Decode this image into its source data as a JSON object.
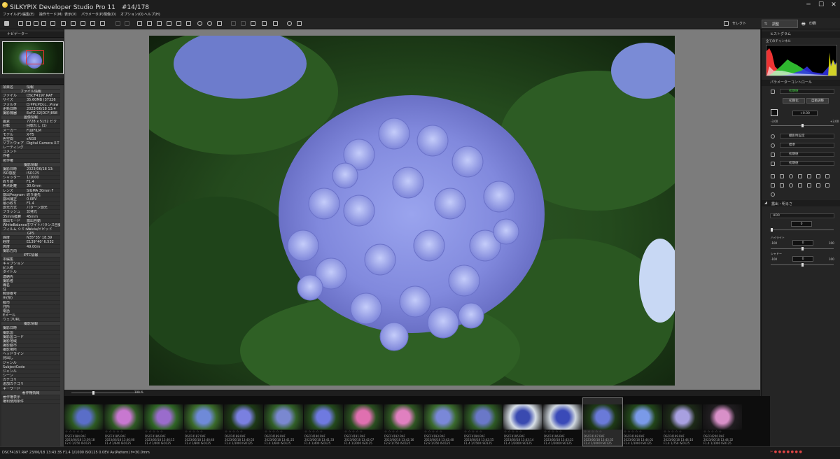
{
  "window": {
    "title": "SILKYPIX Developer Studio Pro 11　#14/178",
    "minimize": "─",
    "maximize": "☐",
    "close": "✕"
  },
  "menu": [
    "ファイル(F)",
    "編集(E)",
    "操作モード(M)",
    "表示(V)",
    "パラメータ(P)",
    "現像(D)",
    "オプション(O)",
    "ヘルプ(H)"
  ],
  "toolbar": {
    "select_label": "セレクト",
    "adjust_label": "調整",
    "print_label": "印刷"
  },
  "navigator": {
    "title": "ナビゲーター"
  },
  "info": {
    "col_key": "項目名",
    "col_val": "情報",
    "rows": [
      {
        "s": "ファイル情報"
      },
      {
        "k": "ファイル",
        "v": "DSCF4197.RAF"
      },
      {
        "k": "サイズ",
        "v": "35.60MB (37326"
      },
      {
        "k": "フォルダ",
        "v": "D:¥Pic¥Dcc...¥raw"
      },
      {
        "k": "更新日時",
        "v": "2023/06/18 13:4"
      },
      {
        "k": "撮影機器",
        "v": "ExFZ 32(DCF)898"
      },
      {
        "s": "画像情報"
      },
      {
        "k": "画素",
        "v": "7728 x 5152 ピク"
      },
      {
        "k": "回転",
        "v": "回転なし (1)"
      },
      {
        "k": "メーカー",
        "v": "FUJIFILM"
      },
      {
        "k": "モデル",
        "v": "X-T5"
      },
      {
        "k": "色空間",
        "v": "sRGB"
      },
      {
        "k": "ソフトウェア",
        "v": "Digital Camera X-T"
      },
      {
        "k": "レーティング",
        "v": ""
      },
      {
        "k": "コメント",
        "v": ""
      },
      {
        "k": "作者",
        "v": ""
      },
      {
        "k": "著作権",
        "v": ""
      },
      {
        "s": "撮影情報"
      },
      {
        "k": "撮影日時",
        "v": "2023/06/18 13:"
      },
      {
        "k": "ISO感度",
        "v": "ISO125"
      },
      {
        "k": "シャッター",
        "v": "1/1000"
      },
      {
        "k": "絞り値",
        "v": "F1.4"
      },
      {
        "k": "焦点距離",
        "v": "30.0mm"
      },
      {
        "k": "レンズ",
        "v": "SIGMA 30mm F"
      },
      {
        "k": "露出Program",
        "v": "絞り優先"
      },
      {
        "k": "露出補正",
        "v": "0.0EV"
      },
      {
        "k": "最小絞り",
        "v": "F1.4"
      },
      {
        "k": "測光方式",
        "v": "パターン測光"
      },
      {
        "k": "フラッシュ",
        "v": "非発光"
      },
      {
        "k": "35mm換算",
        "v": "45mm"
      },
      {
        "k": "露出モード",
        "v": "露出自動"
      },
      {
        "k": "WhiteBalance",
        "v": "ホワイトバランス自動"
      },
      {
        "k": "フィルム シミュレ",
        "v": "Velvia/ビビッド"
      },
      {
        "s": "GPS"
      },
      {
        "k": "緯度",
        "v": "N35°35' 18.39"
      },
      {
        "k": "経度",
        "v": "E139°40' 6.532"
      },
      {
        "k": "高度",
        "v": "49.00m"
      },
      {
        "k": "撮影方向",
        "v": ""
      },
      {
        "s": "IPTC情報"
      },
      {
        "k": "本編集",
        "v": ""
      },
      {
        "k": "キャプション",
        "v": ""
      },
      {
        "k": "記入者",
        "v": ""
      },
      {
        "k": "タイトル",
        "v": ""
      },
      {
        "k": "連絡先",
        "v": ""
      },
      {
        "k": "撮影者",
        "v": ""
      },
      {
        "k": "職名",
        "v": ""
      },
      {
        "k": "住",
        "v": ""
      },
      {
        "k": "郵便番号",
        "v": ""
      },
      {
        "k": "州(県)",
        "v": ""
      },
      {
        "k": "都市",
        "v": ""
      },
      {
        "k": "住所",
        "v": ""
      },
      {
        "k": "電話",
        "v": ""
      },
      {
        "k": "Eメール",
        "v": ""
      },
      {
        "k": "ウェブURL",
        "v": ""
      },
      {
        "s": "撮影情報"
      },
      {
        "k": "撮影日時",
        "v": ""
      },
      {
        "k": "撮影国",
        "v": ""
      },
      {
        "k": "撮影国コード",
        "v": ""
      },
      {
        "k": "撮影地域",
        "v": ""
      },
      {
        "k": "撮影都市",
        "v": ""
      },
      {
        "k": "撮影場所",
        "v": ""
      },
      {
        "k": "ヘッドライン",
        "v": ""
      },
      {
        "k": "見出し",
        "v": ""
      },
      {
        "k": "ジャンル",
        "v": ""
      },
      {
        "k": "SubjectCode",
        "v": ""
      },
      {
        "k": "ジャンル",
        "v": ""
      },
      {
        "k": "シーン",
        "v": ""
      },
      {
        "k": "カテゴリ",
        "v": ""
      },
      {
        "k": "追加カテゴリ",
        "v": ""
      },
      {
        "k": "キーワード",
        "v": ""
      },
      {
        "s": "著作権情報"
      },
      {
        "k": "著作権表示",
        "v": ""
      },
      {
        "k": "権利使用条件",
        "v": ""
      }
    ]
  },
  "histogram": {
    "title": "ヒストグラム",
    "channel": "全てのチャンネル"
  },
  "params": {
    "title": "パラメーターコントロール",
    "preset": "初期値",
    "init_btn": "初期化",
    "auto_btn": "自動調整",
    "exposure_value": "+0.00",
    "exp_min": "-3.00",
    "exp_max": "+3.00",
    "wb": "撮影時設定",
    "contrast": "標準",
    "sharp": "初期値",
    "color": "初期値"
  },
  "exposure_section": {
    "title": "露出・明るさ",
    "mode": "HDR",
    "hdr_value": "0",
    "hl_label": "ハイライト",
    "hl_min": "-100",
    "hl_max": "100",
    "hl_value": "0",
    "shadow_label": "シャドー",
    "sh_min": "-100",
    "sh_max": "100",
    "sh_value": "0"
  },
  "zoom_label": "100 %",
  "filmstrip": [
    {
      "file": "DSCF4184.RAF",
      "date": "2023/06/18 13:39:18",
      "exif": "F2.0 1/250 ISO125"
    },
    {
      "file": "DSCF4185.RAF",
      "date": "2023/06/18 13:40:00",
      "exif": "F1.4 1/640 ISO125"
    },
    {
      "file": "DSCF4186.RAF",
      "date": "2023/06/18 13:40:15",
      "exif": "F1.4 1/400 ISO125"
    },
    {
      "file": "DSCF4187.RAF",
      "date": "2023/06/18 13:40:40",
      "exif": "F1.4 1/800 ISO125"
    },
    {
      "file": "DSCF4188.RAF",
      "date": "2023/06/18 13:40:53",
      "exif": "F1.4 1/1000 ISO125"
    },
    {
      "file": "DSCF4189.RAF",
      "date": "2023/06/18 13:41:25",
      "exif": "F1.4 1/640 ISO125"
    },
    {
      "file": "DSCF4190.RAF",
      "date": "2023/06/18 13:41:33",
      "exif": "F1.4 1/400 ISO125"
    },
    {
      "file": "DSCF4191.RAF",
      "date": "2023/06/18 13:42:07",
      "exif": "F1.4 1/2000 ISO125"
    },
    {
      "file": "DSCF4192.RAF",
      "date": "2023/06/18 13:42:16",
      "exif": "F2.8 1/750 ISO125"
    },
    {
      "file": "DSCF4193.RAF",
      "date": "2023/06/18 13:42:40",
      "exif": "F2.8 1/350 ISO125"
    },
    {
      "file": "DSCF4194.RAF",
      "date": "2023/06/18 13:42:55",
      "exif": "F1.4 1/1500 ISO125"
    },
    {
      "file": "DSCF4195.RAF",
      "date": "2023/06/18 13:43:14",
      "exif": "F1.4 1/2000 ISO125"
    },
    {
      "file": "DSCF4196.RAF",
      "date": "2023/06/18 13:43:21",
      "exif": "F1.4 1/2000 ISO125"
    },
    {
      "file": "DSCF4197.RAF",
      "date": "2023/06/18 13:43:35",
      "exif": "F1.4 1/1000 ISO125"
    },
    {
      "file": "DSCF4198.RAF",
      "date": "2023/06/18 13:44:01",
      "exif": "F1.4 1/1000 ISO125"
    },
    {
      "file": "DSCF4199.RAF",
      "date": "2023/06/18 13:44:16",
      "exif": "F1.4 1/750 ISO125"
    },
    {
      "file": "DSCF4200.RAF",
      "date": "2023/06/18 13:44:32",
      "exif": "F1.4 1/1000 ISO125"
    }
  ],
  "status": "DSCF4197.RAF  23/06/18 13:43:35  F1.4  1/1000  ISO125  0.0EV  Av(Pattern)  f=30.0mm"
}
